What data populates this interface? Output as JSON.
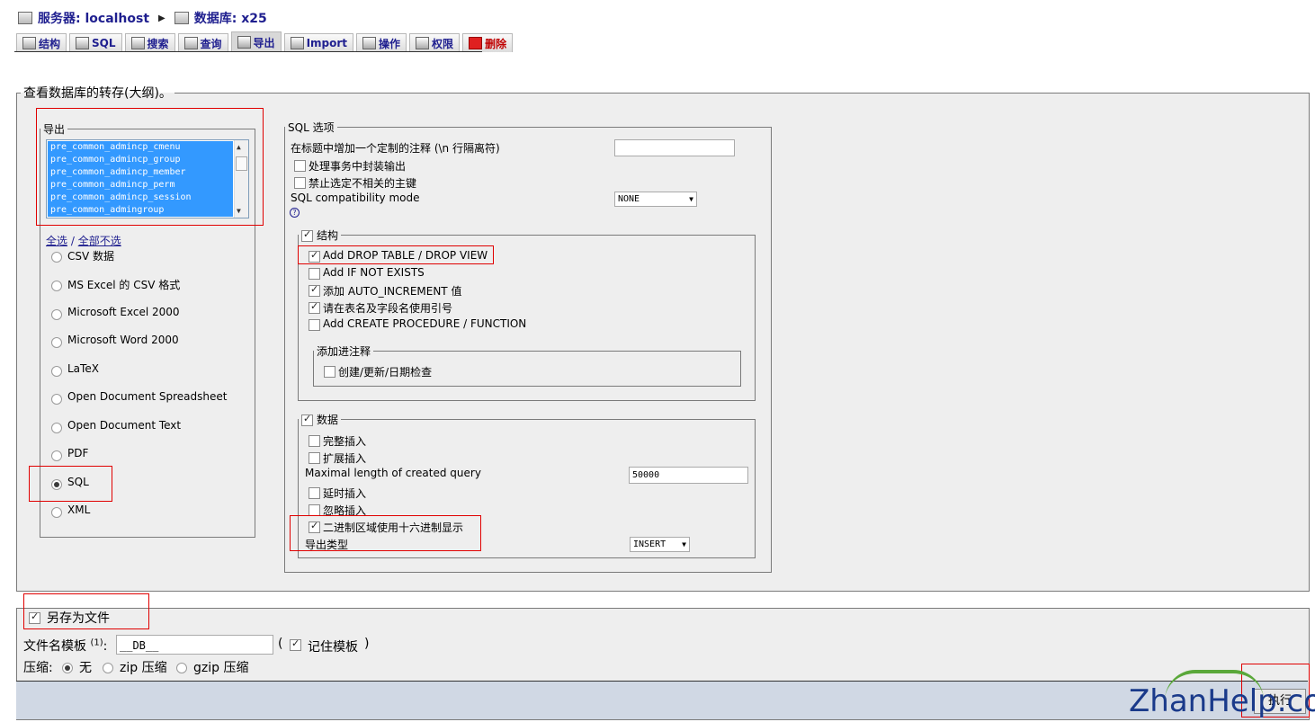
{
  "breadcrumb": {
    "server_label": "服务器: localhost",
    "db_label": "数据库: x25"
  },
  "tabs": [
    {
      "label": "结构",
      "icon": "structure-icon"
    },
    {
      "label": "SQL",
      "icon": "sql-icon"
    },
    {
      "label": "搜索",
      "icon": "search-icon"
    },
    {
      "label": "查询",
      "icon": "query-icon"
    },
    {
      "label": "导出",
      "icon": "export-icon",
      "active": true
    },
    {
      "label": "Import",
      "icon": "import-icon"
    },
    {
      "label": "操作",
      "icon": "operations-icon"
    },
    {
      "label": "权限",
      "icon": "privileges-icon"
    },
    {
      "label": "删除",
      "icon": "drop-icon"
    }
  ],
  "main": {
    "title": "查看数据库的转存(大纲)。",
    "export": {
      "legend": "导出",
      "tables": [
        "pre_common_admincp_cmenu",
        "pre_common_admincp_group",
        "pre_common_admincp_member",
        "pre_common_admincp_perm",
        "pre_common_admincp_session",
        "pre_common_admingroup"
      ],
      "select_all": "全选",
      "slash": "/",
      "deselect_all": "全部不选",
      "formats": [
        "CSV 数据",
        "MS Excel 的 CSV 格式",
        "Microsoft Excel 2000",
        "Microsoft Word 2000",
        "LaTeX",
        "Open Document Spreadsheet",
        "Open Document Text",
        "PDF",
        "SQL",
        "XML"
      ],
      "selected_format": "SQL"
    },
    "sql_options": {
      "legend": "SQL 选项",
      "comment_label": "在标题中增加一个定制的注释 (\\n 行隔离符)",
      "comment_value": "",
      "transaction_label": "处理事务中封装输出",
      "foreign_keys_label": "禁止选定不相关的主键",
      "compat_label": "SQL compatibility mode",
      "compat_value": "NONE",
      "help_glyph": "?",
      "structure": {
        "legend": "结构",
        "drop_table": "Add DROP TABLE / DROP VIEW",
        "if_not_exists": "Add IF NOT EXISTS",
        "auto_increment": "添加 AUTO_INCREMENT 值",
        "backquotes": "请在表名及字段名使用引号",
        "procedure": "Add CREATE PROCEDURE / FUNCTION",
        "comments_legend": "添加进注释",
        "dates": "创建/更新/日期检查"
      },
      "data": {
        "legend": "数据",
        "complete_insert": "完整插入",
        "extended_insert": "扩展插入",
        "max_query_label": "Maximal length of created query",
        "max_query_value": "50000",
        "delayed_insert": "延时插入",
        "ignore_insert": "忽略插入",
        "hex_binary": "二进制区域使用十六进制显示",
        "export_type_label": "导出类型",
        "export_type_value": "INSERT"
      }
    }
  },
  "save": {
    "legend": "另存为文件",
    "filename_label": "文件名模板",
    "filename_sup": "(1)",
    "filename_colon": ":",
    "filename_value": "__DB__",
    "paren_open": "(",
    "paren_close": ")",
    "remember_label": "记住模板",
    "compression_label": "压缩:",
    "compression_none": "无",
    "compression_zip": "zip 压缩",
    "compression_gzip": "gzip 压缩",
    "go_label": "执行"
  },
  "watermark": "ZhanHelp.com",
  "colors": {
    "link": "#1f1f8f",
    "selection": "#3399ff",
    "highlight_box": "#e00000",
    "panel": "#eeeeee"
  }
}
